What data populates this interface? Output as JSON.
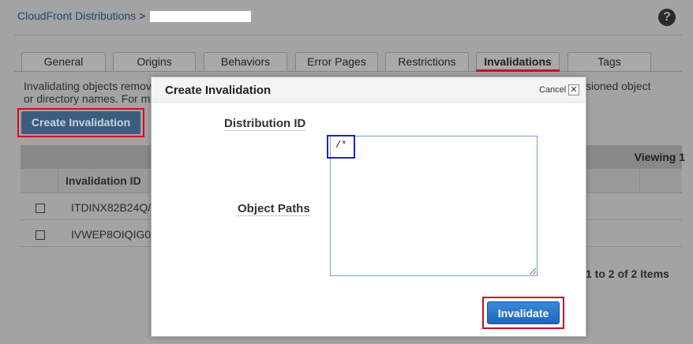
{
  "breadcrumb": {
    "root": "CloudFront Distributions",
    "sep": ">"
  },
  "help": "?",
  "tabs": [
    {
      "label": "General"
    },
    {
      "label": "Origins"
    },
    {
      "label": "Behaviors"
    },
    {
      "label": "Error Pages"
    },
    {
      "label": "Restrictions"
    },
    {
      "label": "Invalidations"
    },
    {
      "label": "Tags"
    }
  ],
  "active_tab": "Invalidations",
  "description": {
    "line1": "Invalidating objects remov",
    "line1_right": "sioned object",
    "line2": "or directory names. For m"
  },
  "create_button": "Create Invalidation",
  "table": {
    "viewing": "Viewing 1",
    "column_id": "Invalidation ID",
    "rows": [
      {
        "id": "ITDINX82B24Q/"
      },
      {
        "id": "IVWEP8OIQIG0"
      }
    ],
    "paging": "1 to 2 of 2 Items"
  },
  "modal": {
    "title": "Create Invalidation",
    "cancel": "Cancel",
    "close": "✕",
    "distribution_label": "Distribution ID",
    "paths_label": "Object Paths",
    "paths_value": "/*",
    "submit": "Invalidate"
  },
  "colors": {
    "highlight_red": "#d10d1d",
    "highlight_blue": "#2020c0",
    "primary_blue": "#1f66bb"
  }
}
